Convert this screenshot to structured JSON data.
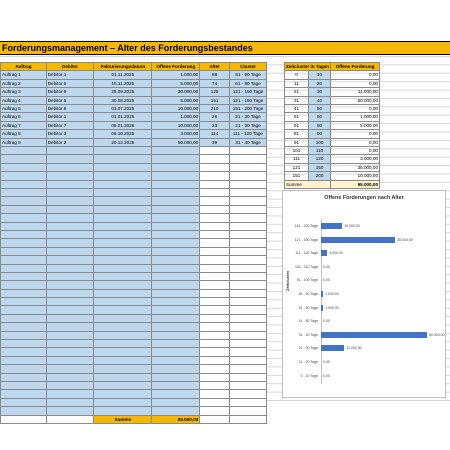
{
  "title": "Forderungsmanagement – Alter des Forderungsbestandes",
  "main_table": {
    "headers": [
      "Auftrag",
      "Debitor",
      "Fakturierungsdatum",
      "Offene Forderung",
      "Alter",
      "Cluster"
    ],
    "rows": [
      [
        "Auftrag 1",
        "Debitor 1",
        "01.11.2025",
        "1.000,00",
        "88",
        "81 - 90 Tage"
      ],
      [
        "Auftrag 2",
        "Debitor 5",
        "15.11.2025",
        "5.000,00",
        "74",
        "61 - 80 Tage"
      ],
      [
        "Auftrag 3",
        "Debitor 9",
        "25.09.2025",
        "30.000,00",
        "125",
        "121 - 150 Tage"
      ],
      [
        "Auftrag 4",
        "Debitor 5",
        "30.08.2025",
        "5.000,00",
        "151",
        "121 - 150 Tage"
      ],
      [
        "Auftrag 5",
        "Debitor 8",
        "03.07.2025",
        "10.000,00",
        "210",
        "151 - 200 Tage"
      ],
      [
        "Auftrag 6",
        "Debitor 1",
        "01.01.2026",
        "1.000,00",
        "26",
        "21 - 30 Tage"
      ],
      [
        "Auftrag 7",
        "Debitor 7",
        "05.01.2026",
        "10.000,00",
        "23",
        "21 - 30 Tage"
      ],
      [
        "Auftrag 8",
        "Debitor 3",
        "06.10.2025",
        "3.000,00",
        "114",
        "111 - 120 Tage"
      ],
      [
        "Auftrag 9",
        "Debitor 2",
        "20.12.2025",
        "50.000,00",
        "39",
        "31 - 40 Tage"
      ]
    ],
    "sum_label": "Summe",
    "sum_value": "95.000,00"
  },
  "cluster_table": {
    "headers": [
      "Zeitcluster in Tagen",
      "",
      "Offene Forderung"
    ],
    "rows": [
      [
        "0",
        "10",
        "0,00"
      ],
      [
        "11",
        "20",
        "0,00"
      ],
      [
        "21",
        "30",
        "11.000,00"
      ],
      [
        "31",
        "40",
        "50.000,00"
      ],
      [
        "41",
        "50",
        "0,00"
      ],
      [
        "51",
        "60",
        "1.000,00"
      ],
      [
        "61",
        "80",
        "5.000,00"
      ],
      [
        "81",
        "90",
        "0,00"
      ],
      [
        "91",
        "100",
        "0,00"
      ],
      [
        "101",
        "110",
        "0,00"
      ],
      [
        "111",
        "120",
        "3.000,00"
      ],
      [
        "121",
        "150",
        "35.000,00"
      ],
      [
        "151",
        "200",
        "10.000,00"
      ]
    ],
    "sum_label": "Summe",
    "sum_value": "95.000,00"
  },
  "chart_data": {
    "type": "bar",
    "title": "Offene Forderungen nach Alter",
    "ylabel": "Zeitcluster",
    "categories": [
      "151 - 200 Tage",
      "121 - 150 Tage",
      "111 - 120 Tage",
      "101 - 110 Tage",
      "91 - 100 Tage",
      "81 - 90 Tage",
      "51 - 60 Tage",
      "41 - 50 Tage",
      "31 - 40 Tage",
      "21 - 30 Tage",
      "11 - 20 Tage",
      "0 - 10 Tage"
    ],
    "values": [
      10000,
      35000,
      3000,
      0,
      0,
      1000,
      1000,
      0,
      50000,
      11000,
      0,
      0
    ],
    "labels": [
      "10.000,00",
      "35.000,00",
      "3.000,00",
      "0,00",
      "0,00",
      "1.000,00",
      "1.000,00",
      "0,00",
      "50.000,00",
      "11.000,00",
      "0,00",
      "0,00"
    ],
    "color": "#4472c4"
  }
}
